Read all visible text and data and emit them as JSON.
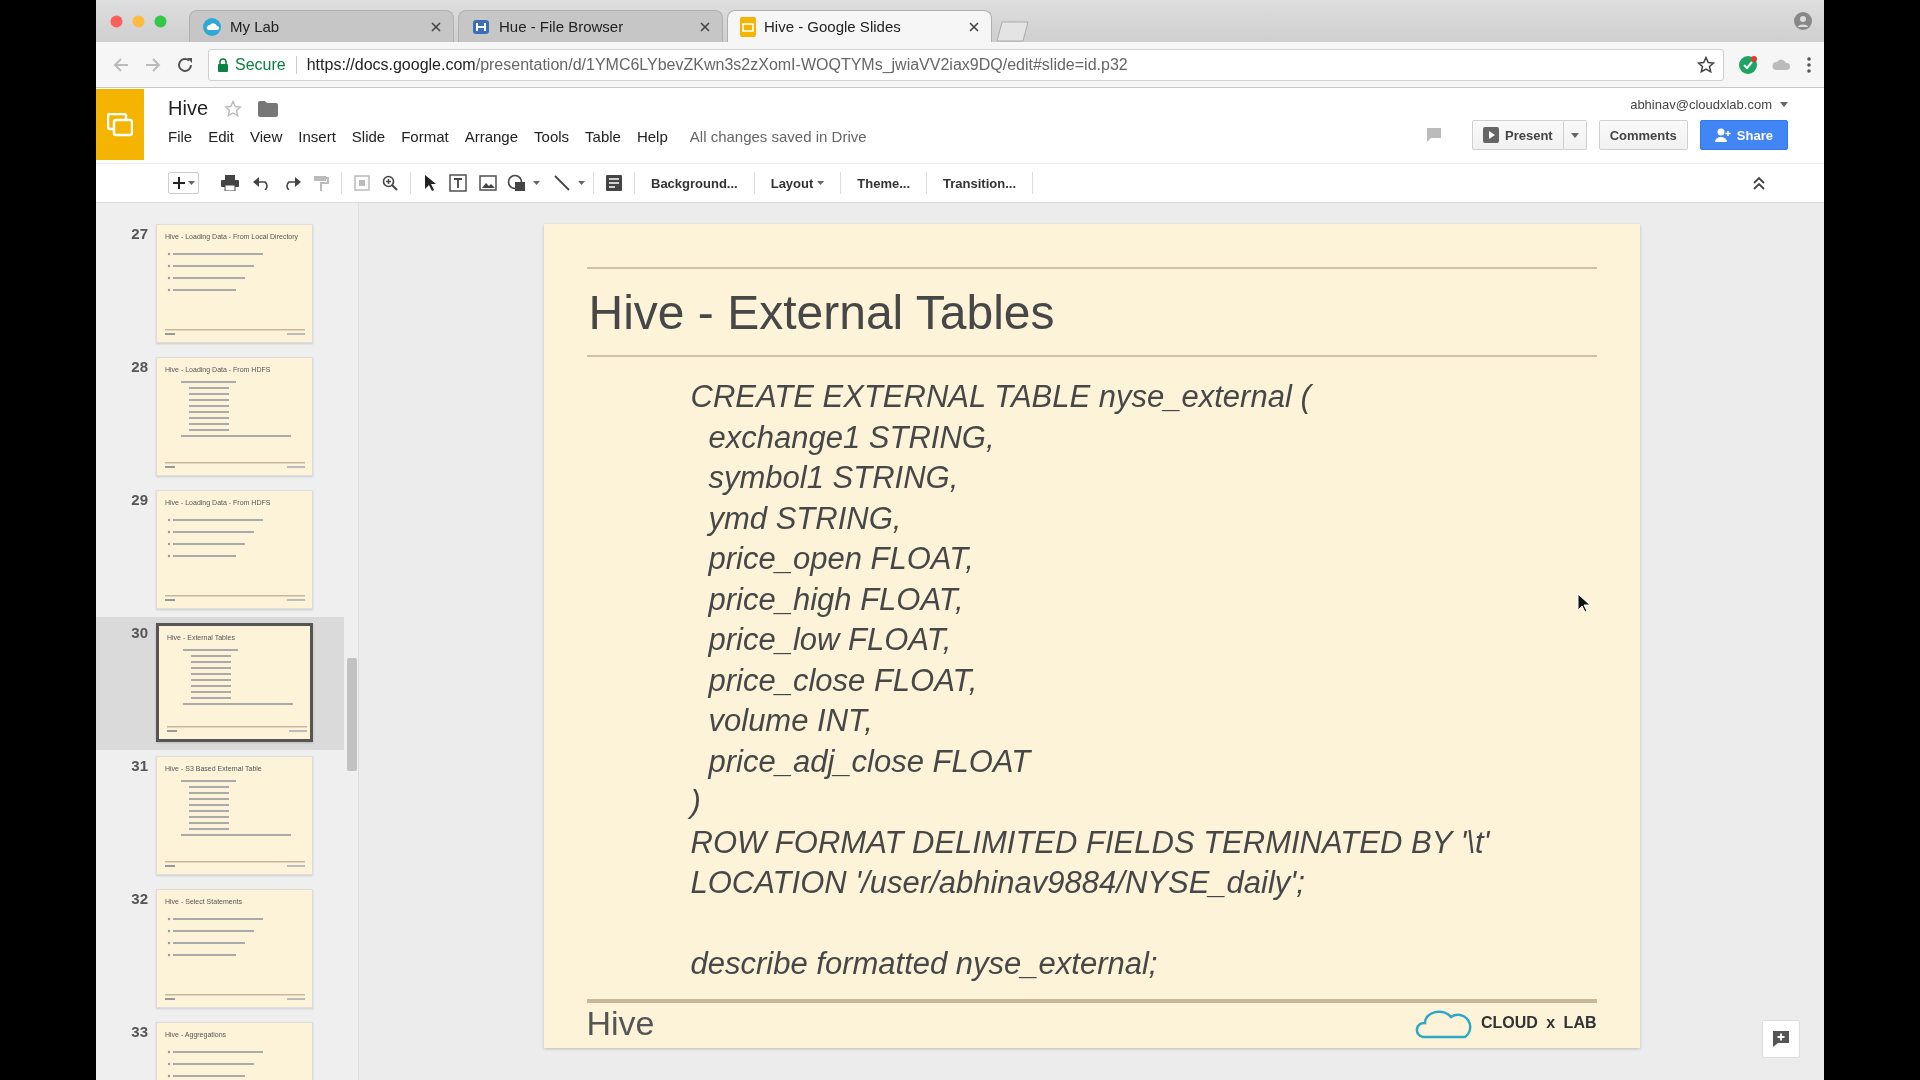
{
  "browser": {
    "tabs": [
      {
        "title": "My Lab",
        "kind": "cloud",
        "selected": false
      },
      {
        "title": "Hue - File Browser",
        "kind": "hue",
        "selected": false
      },
      {
        "title": "Hive - Google Slides",
        "kind": "slides",
        "selected": true
      }
    ],
    "secure_label": "Secure",
    "url_host": "https://docs.google.com",
    "url_path": "/presentation/d/1YMC6LYbevZKwn3s2zXomI-WOQTYMs_jwiaVV2iax9DQ/edit#slide=id.p32"
  },
  "document": {
    "title": "Hive",
    "account": "abhinav@cloudxlab.com",
    "save_status": "All changes saved in Drive",
    "menu": [
      "File",
      "Edit",
      "View",
      "Insert",
      "Slide",
      "Format",
      "Arrange",
      "Tools",
      "Table",
      "Help"
    ],
    "present": "Present",
    "comments": "Comments",
    "share": "Share"
  },
  "toolbar": {
    "text_buttons": [
      {
        "label": "Background...",
        "dropdown": false
      },
      {
        "label": "Layout",
        "dropdown": true
      },
      {
        "label": "Theme...",
        "dropdown": false
      },
      {
        "label": "Transition...",
        "dropdown": false
      }
    ]
  },
  "slides": [
    {
      "number": "27",
      "title": "Hive - Loading Data - From Local Directory",
      "kind": "bullets",
      "selected": false
    },
    {
      "number": "28",
      "title": "Hive - Loading Data - From HDFS",
      "kind": "code",
      "selected": false
    },
    {
      "number": "29",
      "title": "Hive - Loading Data - From HDFS",
      "kind": "bullets",
      "selected": false
    },
    {
      "number": "30",
      "title": "Hive - External Tables",
      "kind": "code",
      "selected": true
    },
    {
      "number": "31",
      "title": "Hive - S3 Based External Table",
      "kind": "code",
      "selected": false
    },
    {
      "number": "32",
      "title": "Hive - Select Statements",
      "kind": "bullets",
      "selected": false
    },
    {
      "number": "33",
      "title": "Hive - Aggregations",
      "kind": "bullets",
      "selected": false
    }
  ],
  "slide": {
    "title": "Hive - External Tables",
    "code_lines": [
      {
        "text": "CREATE EXTERNAL TABLE  nyse_external (",
        "kind": "statement"
      },
      {
        "text": "exchange1 STRING,",
        "kind": "column"
      },
      {
        "text": "symbol1 STRING,",
        "kind": "column"
      },
      {
        "text": "ymd STRING,",
        "kind": "column"
      },
      {
        "text": "price_open FLOAT,",
        "kind": "column"
      },
      {
        "text": "price_high FLOAT,",
        "kind": "column"
      },
      {
        "text": "price_low FLOAT,",
        "kind": "column"
      },
      {
        "text": "price_close FLOAT,",
        "kind": "column"
      },
      {
        "text": "volume INT,",
        "kind": "column"
      },
      {
        "text": "price_adj_close FLOAT",
        "kind": "column"
      },
      {
        "text": ")",
        "kind": "statement"
      },
      {
        "text": "ROW FORMAT DELIMITED FIELDS TERMINATED BY '\\t'",
        "kind": "statement"
      },
      {
        "text": "LOCATION '/user/abhinav9884/NYSE_daily';",
        "kind": "statement"
      },
      {
        "text": "describe formatted nyse_external;",
        "kind": "spaced"
      }
    ],
    "footer": "Hive",
    "logo_text": "CLOUD x LAB"
  }
}
